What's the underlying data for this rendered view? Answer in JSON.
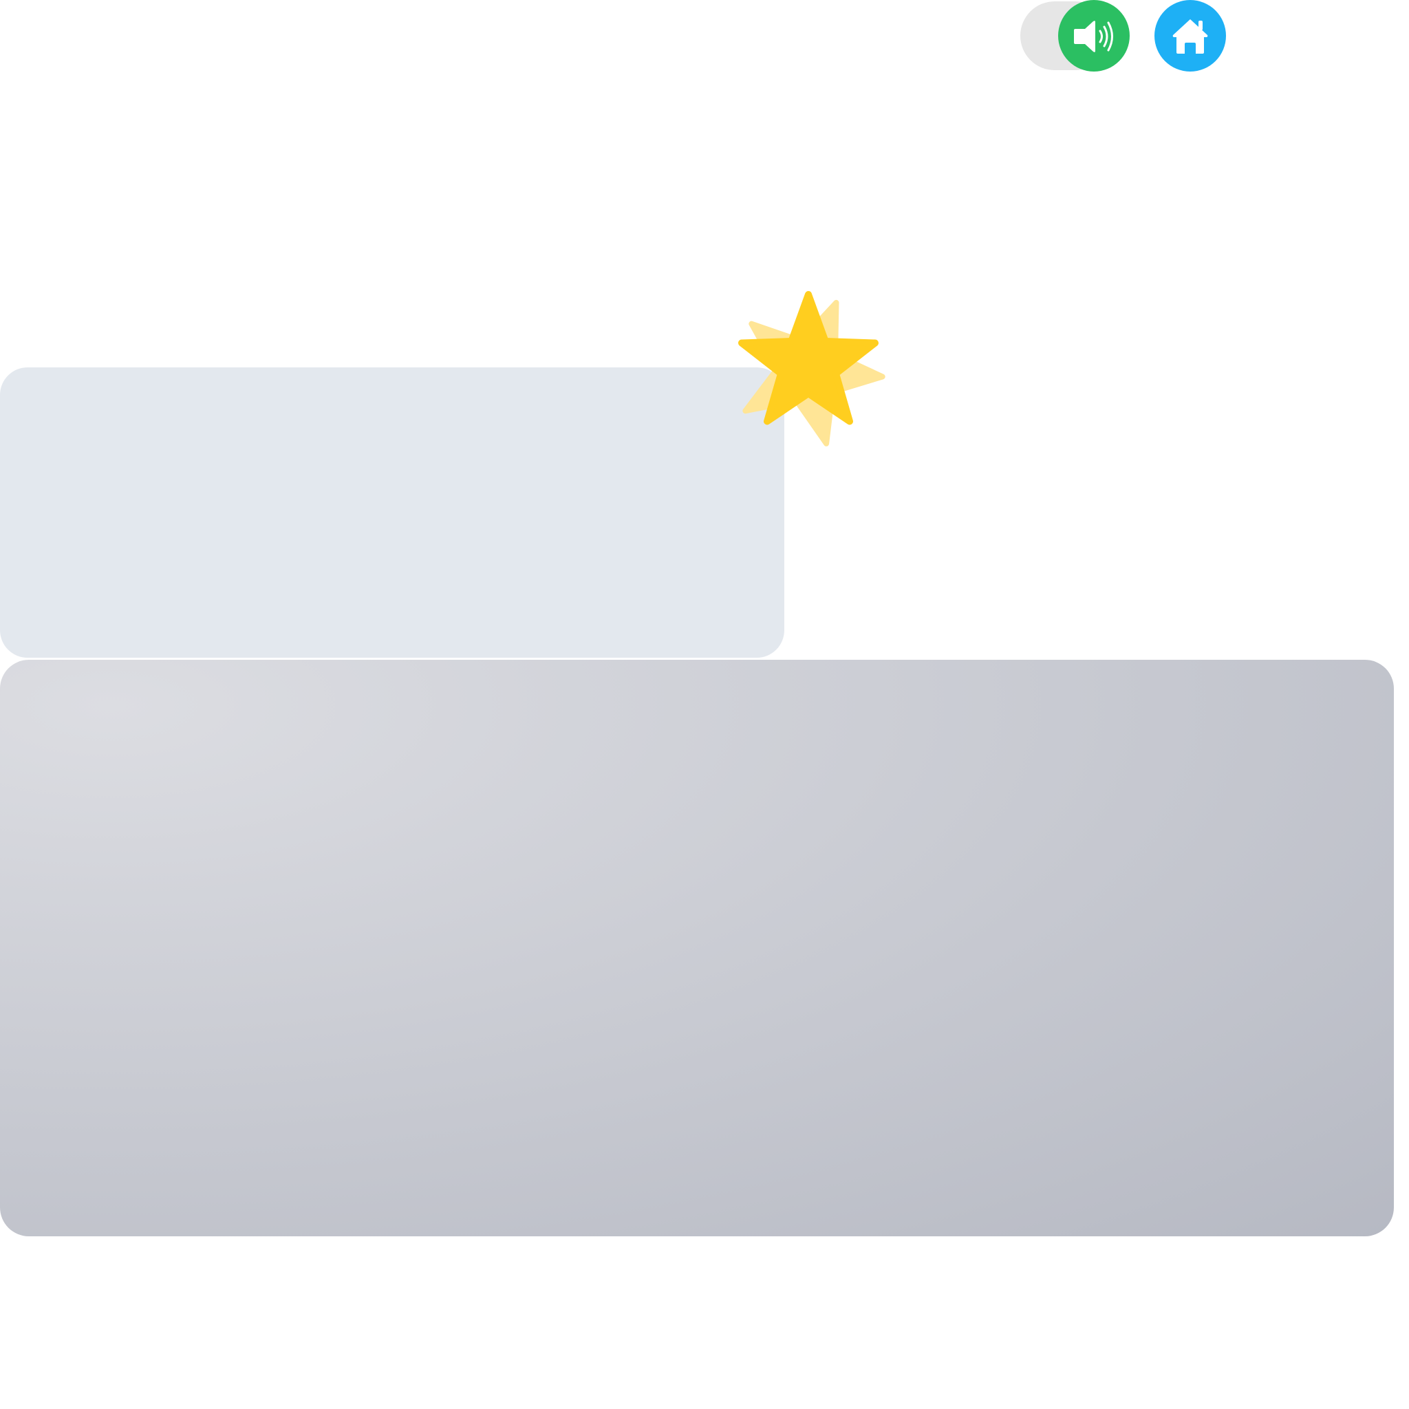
{
  "controls": {
    "sound_toggle": {
      "icon": "speaker-icon",
      "state": "on",
      "track_color": "#e6e6e6",
      "knob_color": "#2bbf62"
    },
    "home_button": {
      "icon": "home-icon",
      "color": "#1eb0f5"
    }
  },
  "reward": {
    "icon": "star-icon",
    "color": "#ffce1f",
    "glow_color": "#ffe596"
  },
  "panels": {
    "top_panel": {
      "color": "#e3e8ee"
    },
    "main_panel": {
      "gradient_start": "#dcdde2",
      "gradient_end": "#b6b9c3"
    }
  }
}
